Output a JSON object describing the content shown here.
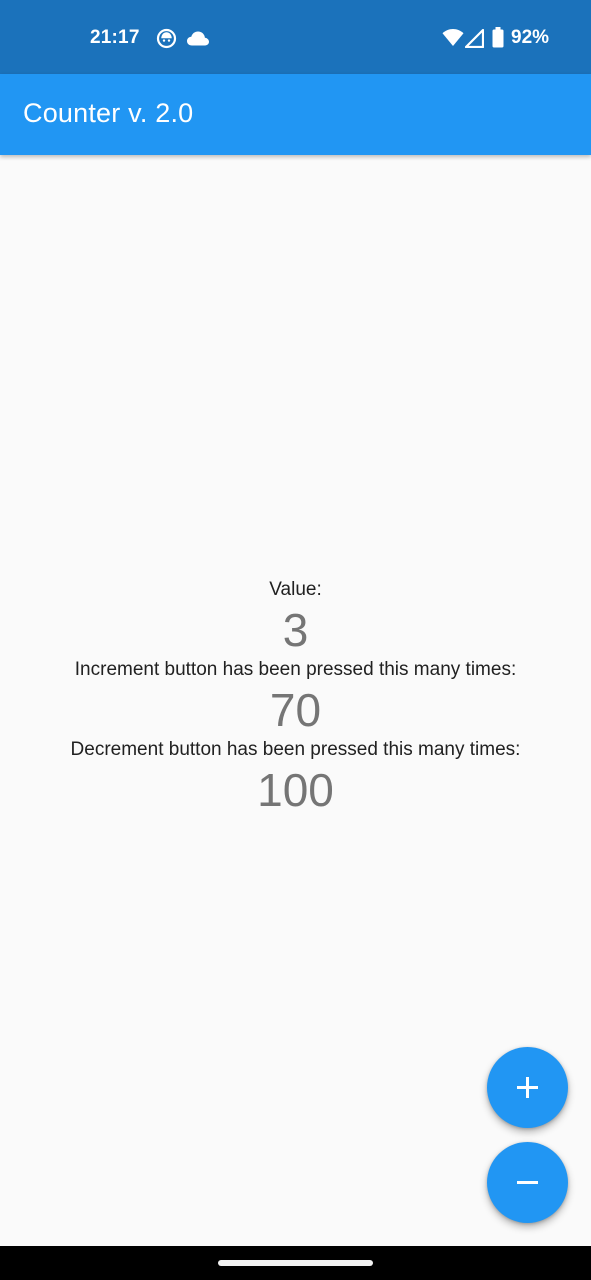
{
  "status_bar": {
    "time": "21:17",
    "battery": "92%",
    "icons": [
      "notification-app-icon",
      "cloud-icon",
      "wifi-icon",
      "cell-signal-icon",
      "battery-icon"
    ]
  },
  "app_bar": {
    "title": "Counter v. 2.0"
  },
  "counter": {
    "value_label": "Value:",
    "value": "3",
    "increment_label": "Increment button has been pressed this many times:",
    "increment_count": "70",
    "decrement_label": "Decrement button has been pressed this many times:",
    "decrement_count": "100"
  },
  "buttons": {
    "increment_icon": "add-icon",
    "decrement_icon": "remove-icon"
  },
  "colors": {
    "status_bar": "#1b72bb",
    "app_bar": "#2196f3",
    "fab": "#2196f3",
    "background": "#fafafa",
    "value_text": "#757575"
  }
}
